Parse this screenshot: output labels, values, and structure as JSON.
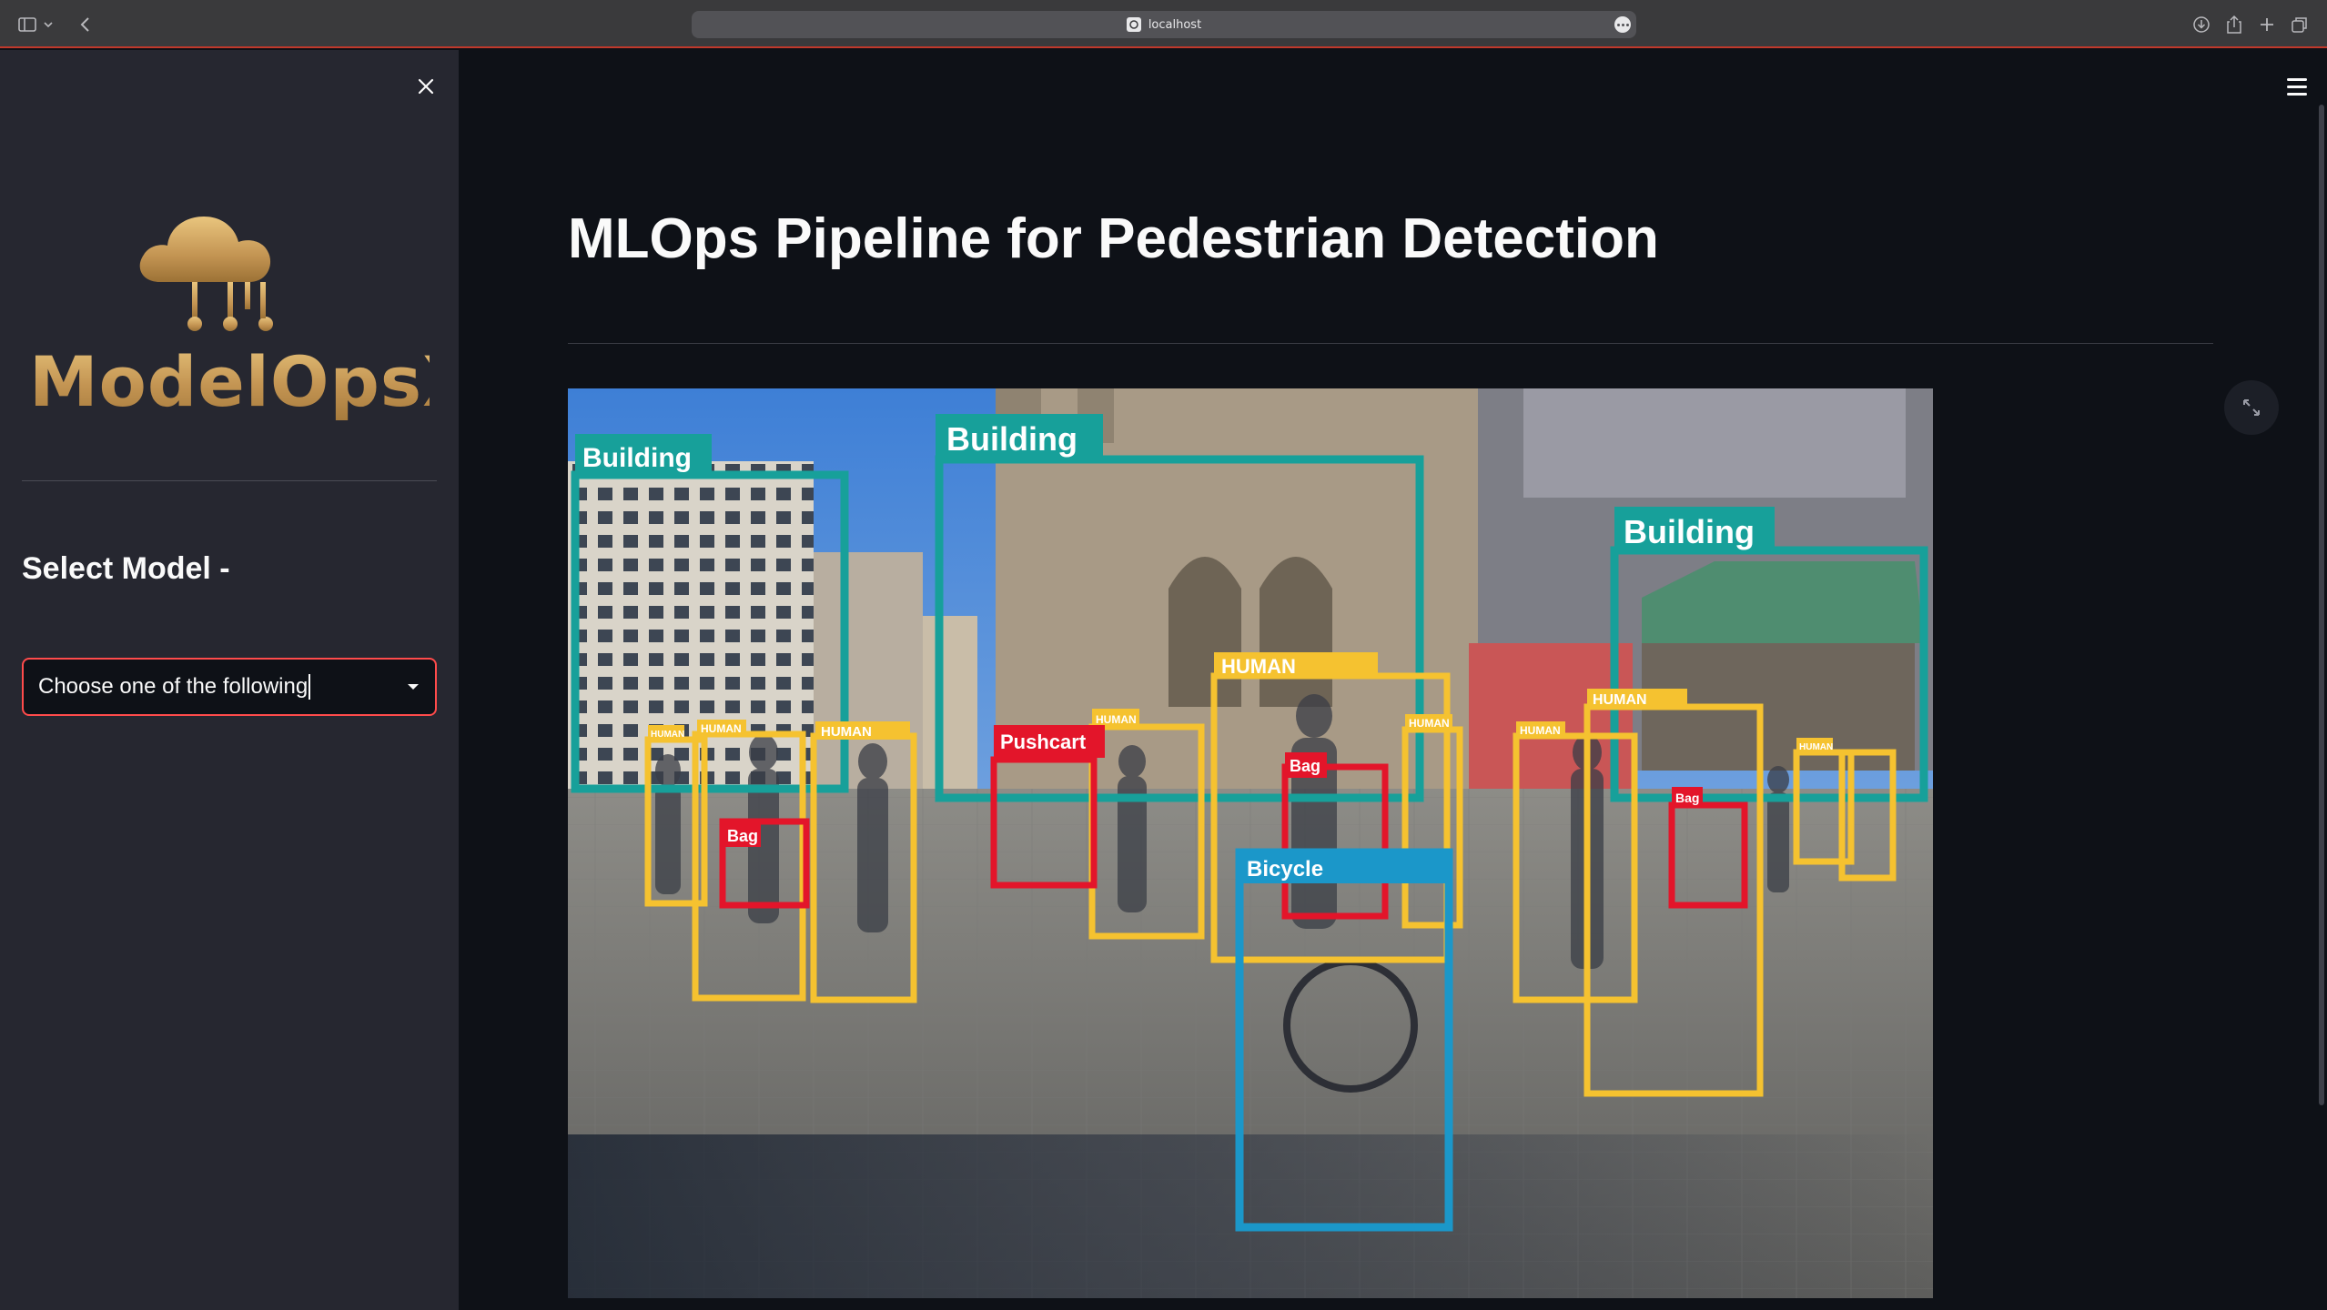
{
  "browser": {
    "url": "localhost"
  },
  "sidebar": {
    "brand_name": "ModelOpsX",
    "select_heading": "Select Model -",
    "select_value": "Choose one of the following"
  },
  "main": {
    "title": "MLOps Pipeline for Pedestrian Detection"
  },
  "hero_image": {
    "labels": {
      "building_1": "Building",
      "building_2": "Building",
      "building_3": "Building",
      "human_1": "HUMAN",
      "human_2": "HUMAN",
      "human_3": "HUMAN",
      "human_4": "HUMAN",
      "human_5": "HUMAN",
      "human_6": "HUMAN",
      "human_7": "HUMAN",
      "human_8": "HUMAN",
      "human_9": "HUMAN",
      "bag_1": "Bag",
      "bag_2": "Bag",
      "bag_3": "Bag",
      "pushcart": "Pushcart",
      "bicycle": "Bicycle"
    }
  },
  "colors": {
    "accent": "#ff4b4b",
    "building_box": "#17a09a",
    "human_box": "#f5c230",
    "bag_box": "#e3152a",
    "bicycle_box": "#1b97c9",
    "gold": "#c9a15b"
  }
}
